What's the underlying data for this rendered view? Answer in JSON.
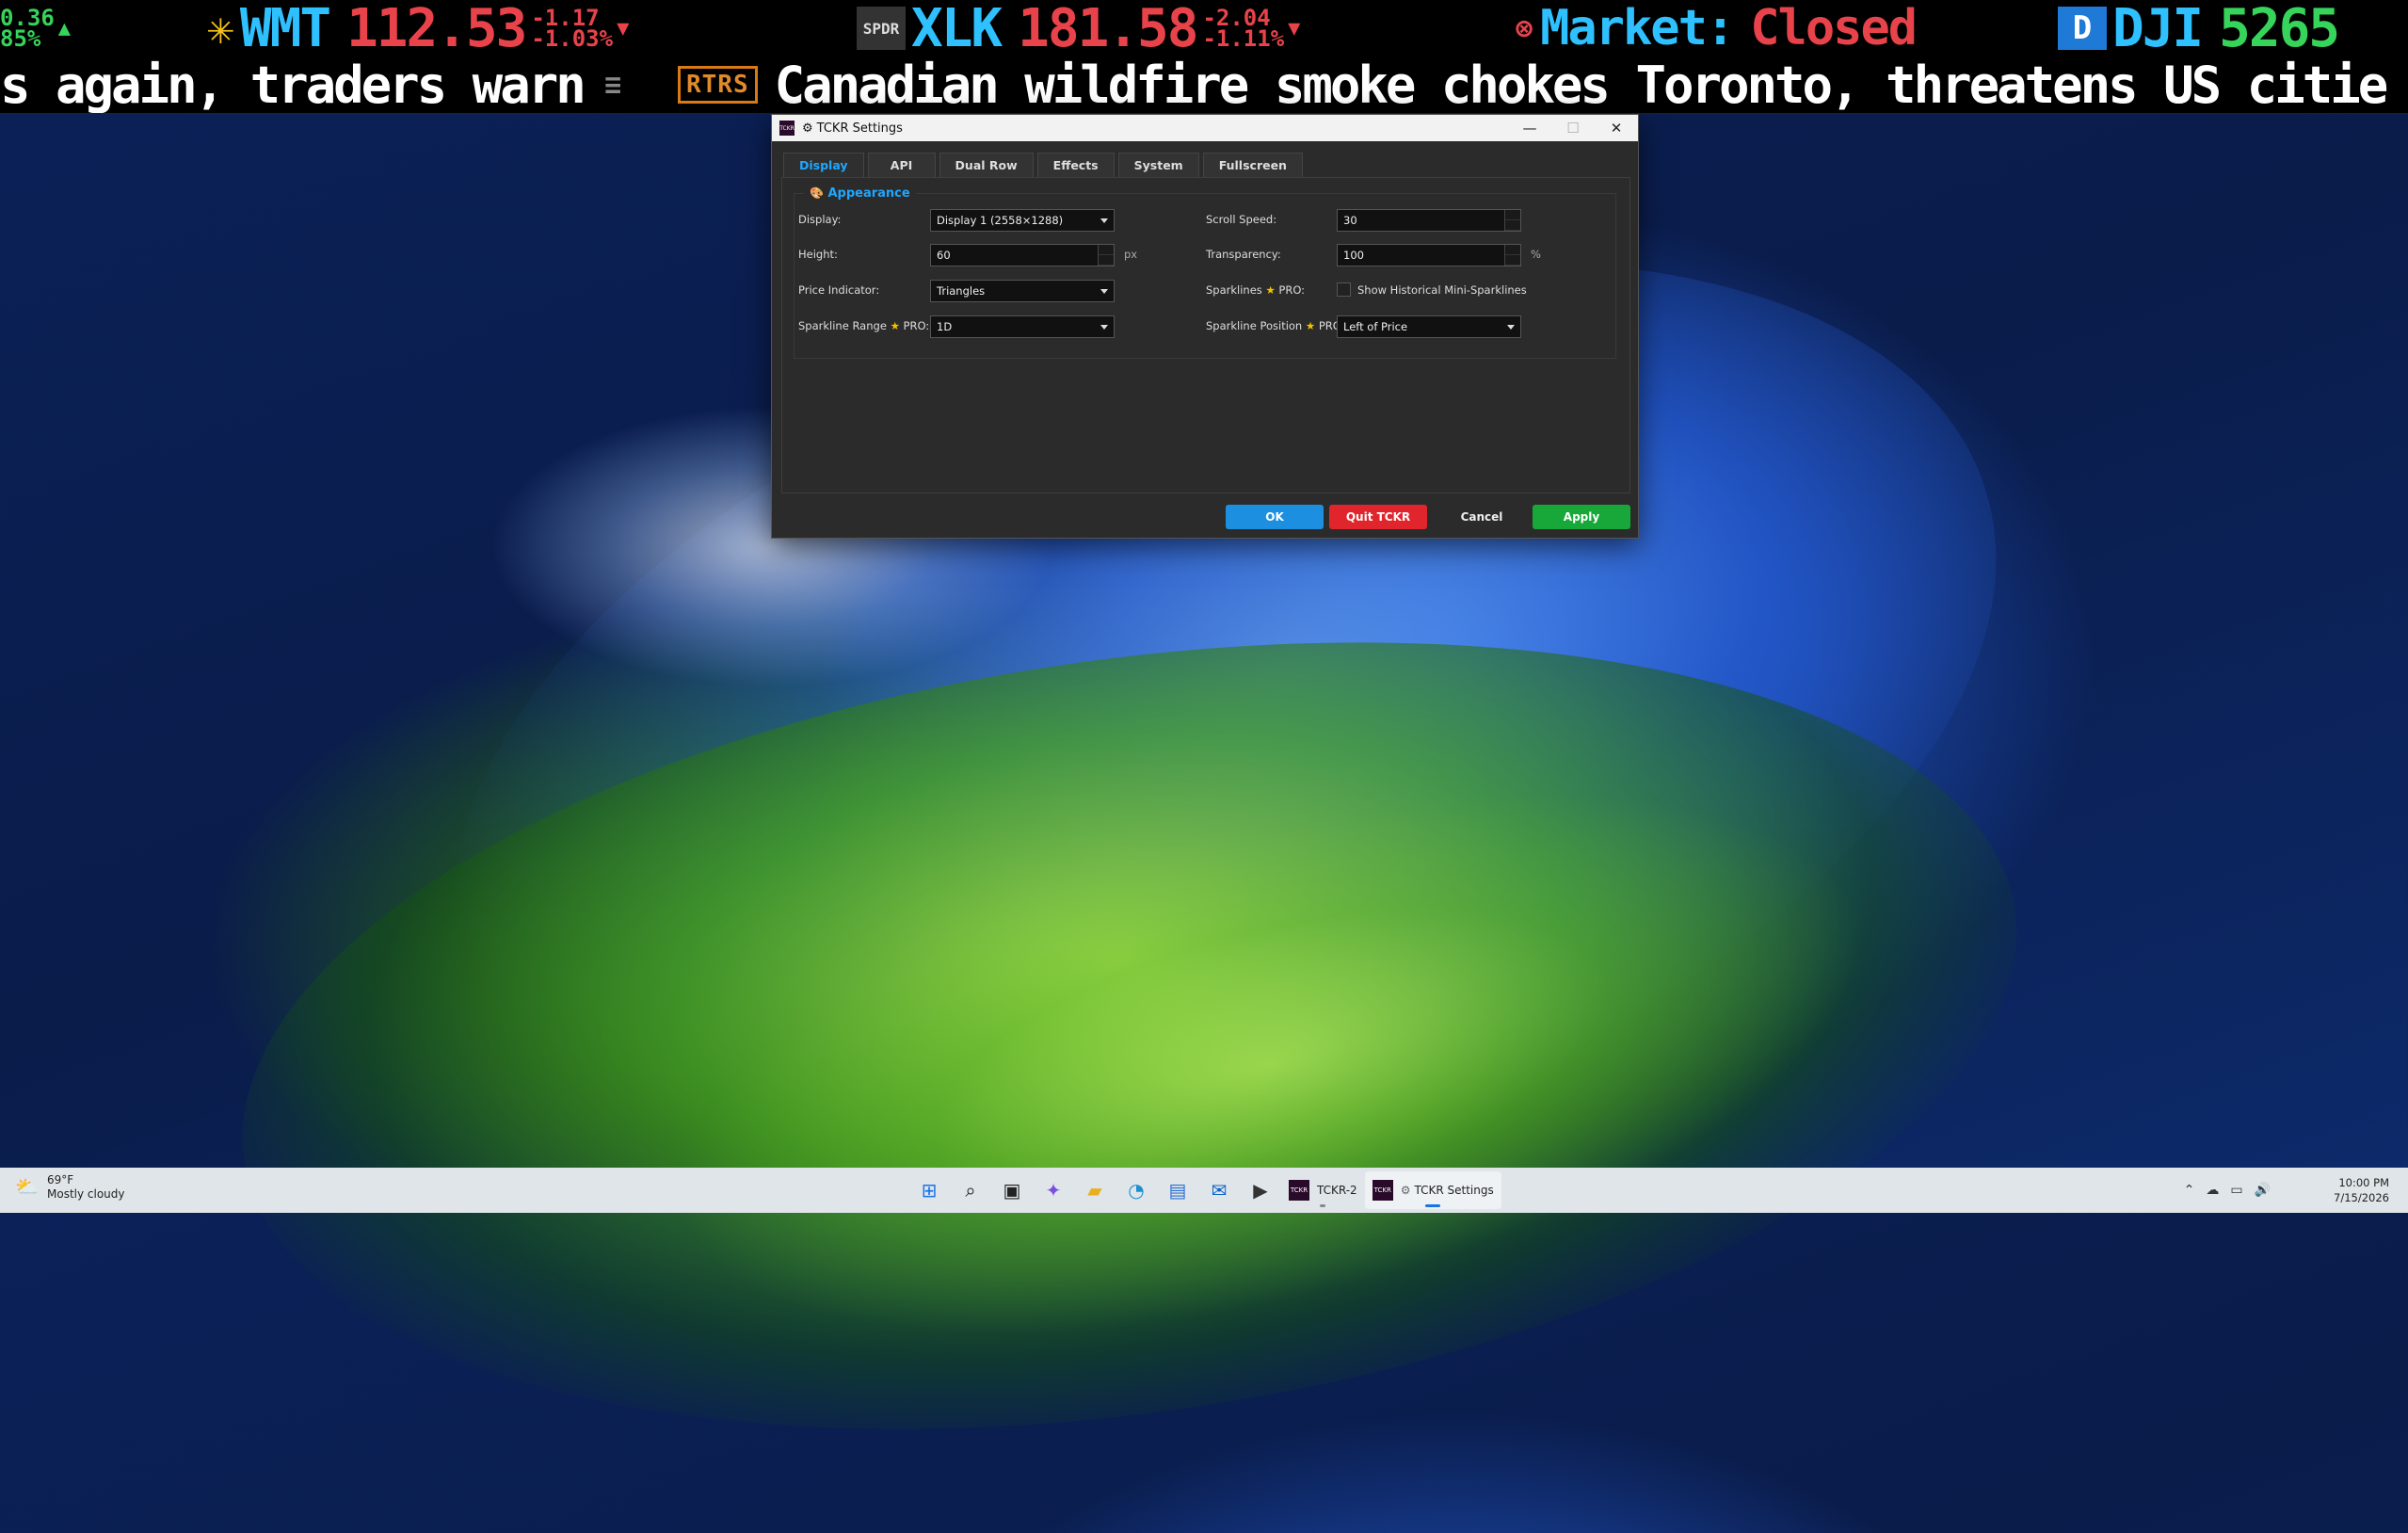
{
  "ticker_top": {
    "items": [
      {
        "change_abs": "0.36",
        "change_pct": "85%",
        "color": "#36d45a"
      },
      {
        "symbol": "WMT",
        "price": "112.53",
        "change_abs": "-1.17",
        "change_pct": "-1.03%",
        "color": "#e8434b",
        "logo": "walmart-spark"
      },
      {
        "logo_text": "SPDR",
        "symbol": "XLK",
        "price": "181.58",
        "change_abs": "-2.04",
        "change_pct": "-1.11%",
        "color": "#e8434b"
      },
      {
        "label": "Market: Closed",
        "color_label": "#2ec0ff",
        "color_status": "#e8434b"
      },
      {
        "symbol": "DJI",
        "price": "5265",
        "color": "#36d45a",
        "logo_text": "D"
      }
    ]
  },
  "ticker_news": {
    "text_left": "s again, traders warn",
    "separator": "≡",
    "source": "RTRS",
    "headline": "Canadian wildfire smoke chokes Toronto, threatens US citie"
  },
  "dialog": {
    "title": "TCKR Settings",
    "app_icon_text": "TCKR",
    "tabs": [
      {
        "label": "Display",
        "active": true
      },
      {
        "label": "API"
      },
      {
        "label": "Dual Row"
      },
      {
        "label": "Effects"
      },
      {
        "label": "System"
      },
      {
        "label": "Fullscreen"
      }
    ],
    "group_title": "Appearance",
    "fields": {
      "display_label": "Display:",
      "display_value": "Display 1 (2558×1288)",
      "height_label": "Height:",
      "height_value": "60",
      "height_unit": "px",
      "price_indicator_label": "Price Indicator:",
      "price_indicator_value": "Triangles",
      "sparkline_range_label": "Sparkline Range",
      "sparkline_range_pro": "PRO:",
      "sparkline_range_value": "1D",
      "scroll_speed_label": "Scroll Speed:",
      "scroll_speed_value": "30",
      "transparency_label": "Transparency:",
      "transparency_value": "100",
      "transparency_unit": "%",
      "sparklines_label": "Sparklines",
      "sparklines_pro": "PRO:",
      "sparklines_checkbox_label": "Show Historical Mini-Sparklines",
      "sparklines_checked": false,
      "sparkline_position_label": "Sparkline Position",
      "sparkline_position_pro": "PRO:",
      "sparkline_position_value": "Left of Price"
    },
    "buttons": {
      "ok": "OK",
      "quit": "Quit TCKR",
      "cancel": "Cancel",
      "apply": "Apply"
    },
    "accent_color": "#1ea7ff"
  },
  "taskbar": {
    "weather_temp": "69°F",
    "weather_desc": "Mostly cloudy",
    "pinned_icons": [
      "start-icon",
      "search-icon",
      "task-view-icon",
      "copilot-icon",
      "file-explorer-icon",
      "edge-icon",
      "store-icon",
      "outlook-icon",
      "terminal-icon"
    ],
    "apps": [
      {
        "label": "TCKR-2",
        "icon_text": "TCKR"
      },
      {
        "label": "TCKR Settings",
        "icon_text": "TCKR",
        "active": true
      }
    ],
    "clock_time": "10:00 PM",
    "clock_date": "7/15/2026"
  }
}
